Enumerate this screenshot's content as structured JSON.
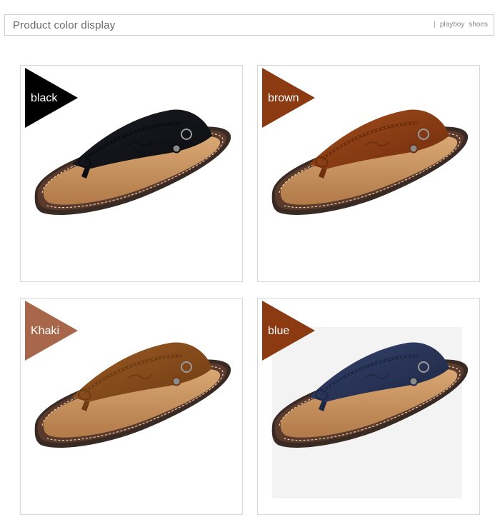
{
  "header": {
    "title": "Product color display",
    "divider": "|",
    "brand_word1": "playboy",
    "brand_word2": "shoes"
  },
  "variants": [
    {
      "label": "black",
      "tag_color": "#000000",
      "strap_color": "#1b1d23",
      "strap_dark": "#0b0c10"
    },
    {
      "label": "brown",
      "tag_color": "#8b3a12",
      "strap_color": "#a44d1c",
      "strap_dark": "#6e2d0c"
    },
    {
      "label": "Khaki",
      "tag_color": "#a8674a",
      "strap_color": "#9b5a24",
      "strap_dark": "#6f3c12"
    },
    {
      "label": "blue",
      "tag_color": "#8b3a12",
      "strap_color": "#34426b",
      "strap_dark": "#1e2744"
    }
  ]
}
